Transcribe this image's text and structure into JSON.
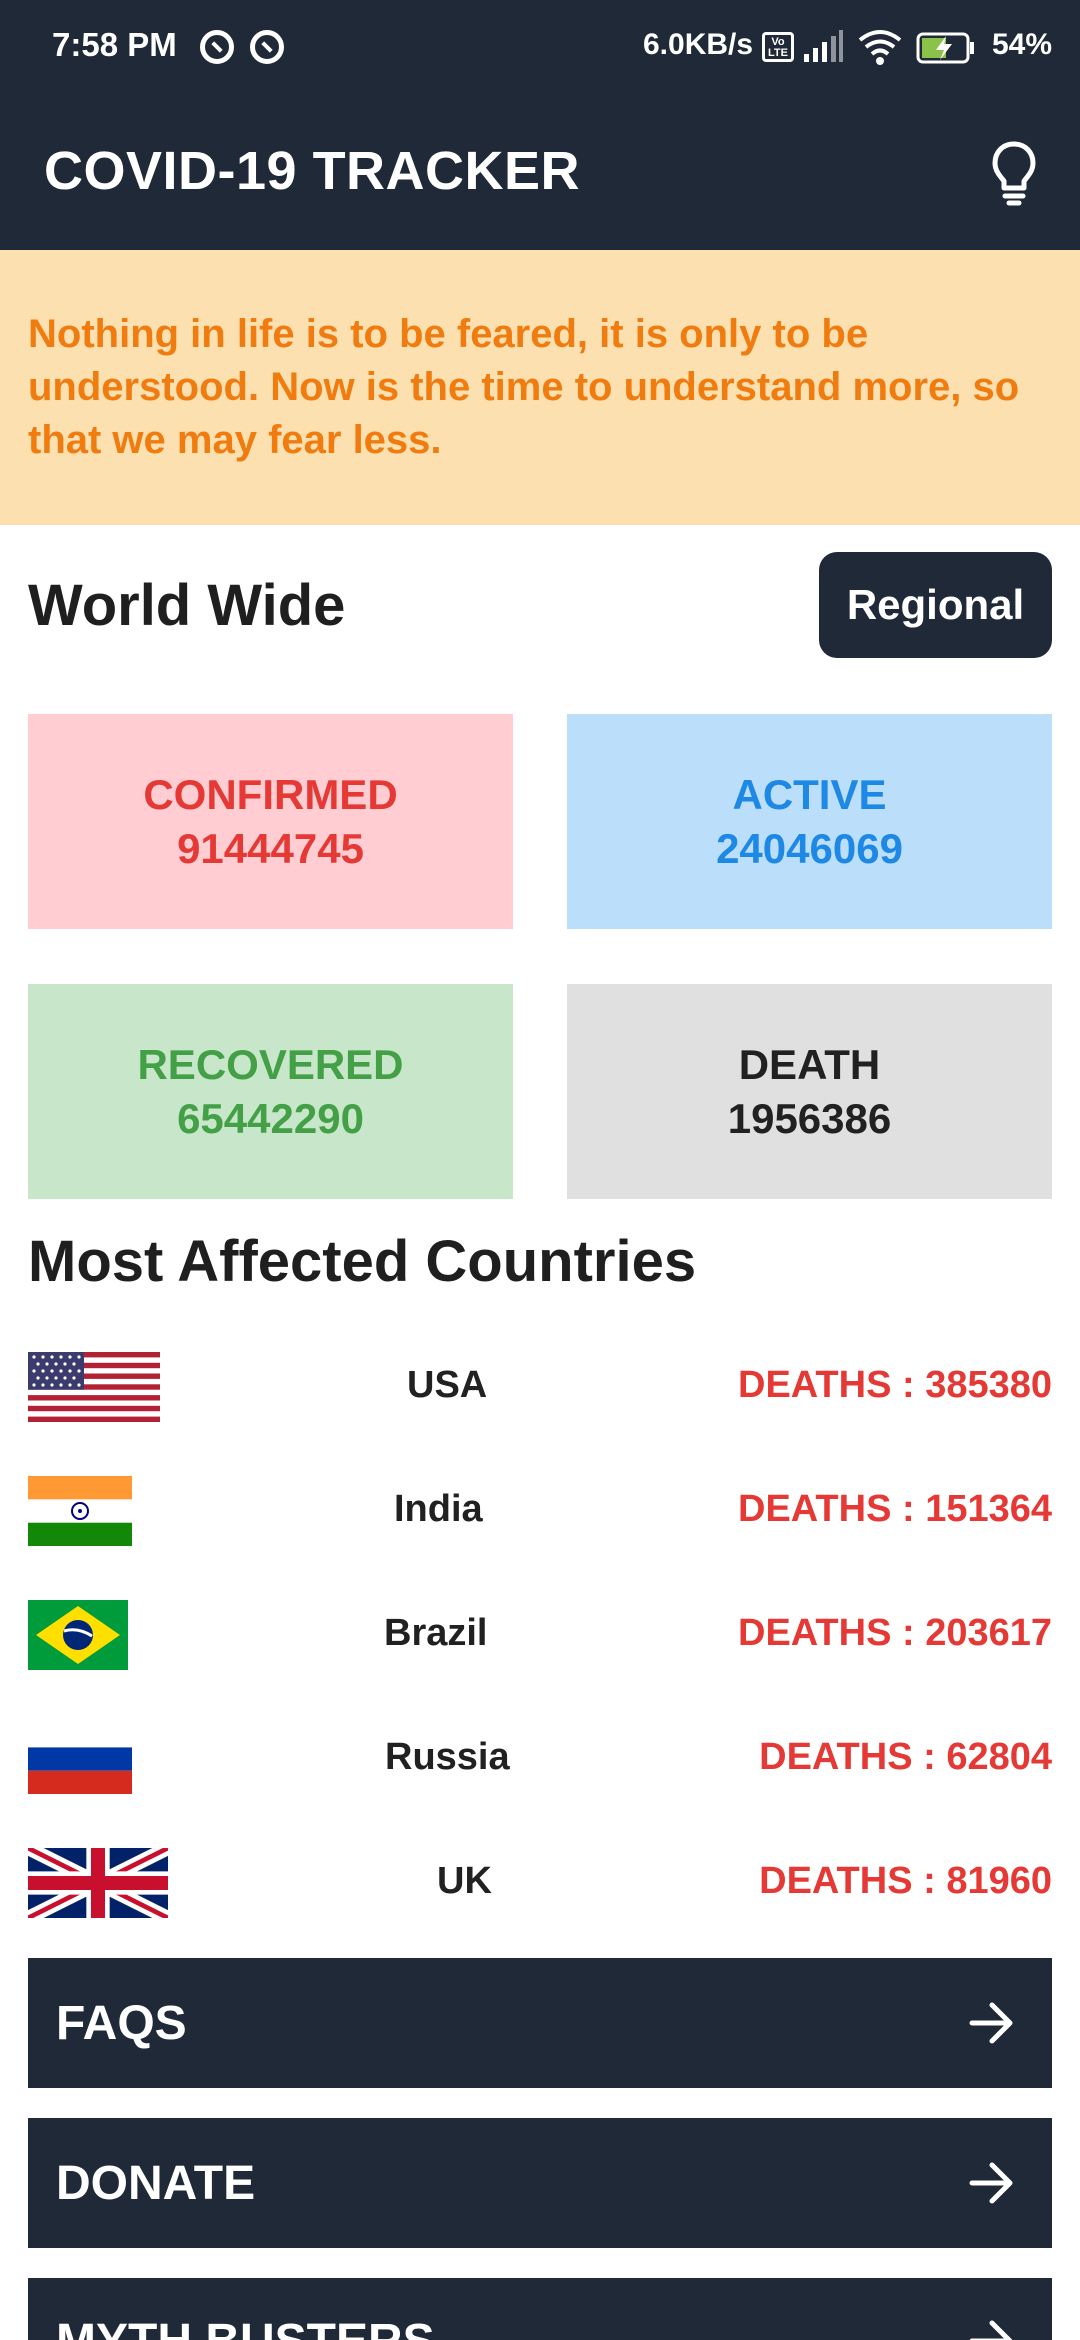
{
  "status_bar": {
    "time": "7:58 PM",
    "net_speed": "6.0KB/s",
    "volte": "Vo LTE",
    "battery": "54%",
    "icons": [
      "notification-icon",
      "notification-icon",
      "volte-icon",
      "signal-icon",
      "wifi-icon",
      "battery-charging-icon"
    ]
  },
  "app_bar": {
    "title": "COVID-19 TRACKER",
    "theme_icon": "lightbulb-icon"
  },
  "quote": "Nothing in life is to be feared, it is only to be understood. Now is the time to understand more, so that we may fear less.",
  "world": {
    "title": "World Wide",
    "regional_label": "Regional",
    "confirmed_label": "CONFIRMED",
    "confirmed_value": "91444745",
    "active_label": "ACTIVE",
    "active_value": "24046069",
    "recovered_label": "RECOVERED",
    "recovered_value": "65442290",
    "death_label": "DEATH",
    "death_value": "1956386"
  },
  "countries": {
    "title": "Most Affected Countries",
    "items": [
      {
        "name": "USA",
        "deaths": "DEATHS : 385380",
        "flag": "usa-flag-icon"
      },
      {
        "name": "India",
        "deaths": "DEATHS : 151364",
        "flag": "india-flag-icon"
      },
      {
        "name": "Brazil",
        "deaths": "DEATHS : 203617",
        "flag": "brazil-flag-icon"
      },
      {
        "name": "Russia",
        "deaths": "DEATHS : 62804",
        "flag": "russia-flag-icon"
      },
      {
        "name": "UK",
        "deaths": "DEATHS : 81960",
        "flag": "uk-flag-icon"
      }
    ]
  },
  "nav": {
    "faqs": "FAQS",
    "donate": "DONATE",
    "myth_busters": "MYTH BUSTERS"
  },
  "colors": {
    "primary_dark": "#1f2937",
    "quote_bg": "#fde0b0",
    "quote_text": "#f07c10",
    "confirmed": "#e53935",
    "active": "#1e88e5",
    "recovered": "#43a047",
    "death": "#212121"
  }
}
